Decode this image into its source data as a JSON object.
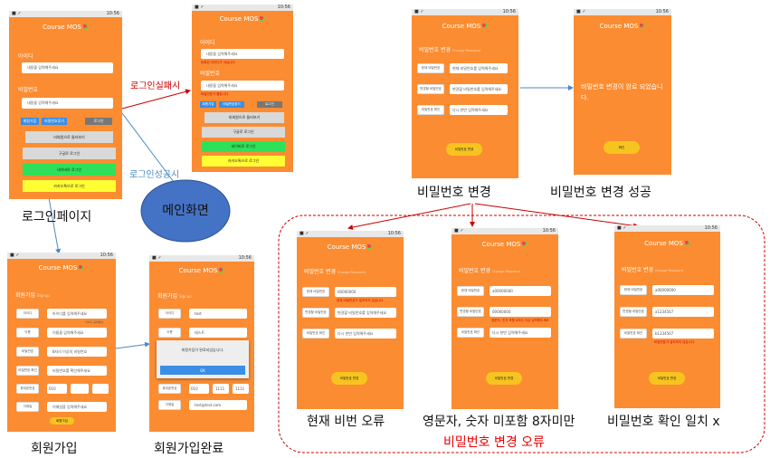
{
  "app": {
    "logo": "Course MOS",
    "time": "10:56"
  },
  "login": {
    "id_label": "아이디",
    "id_placeholder": "내용을 입력해주세요",
    "pw_label": "비밀번호",
    "pw_placeholder": "내용을 입력해주세요",
    "signup": "회원가입",
    "find_pw": "비밀번호찾기",
    "login": "로그인",
    "guest": "비회원으로 둘러보기",
    "google": "구글로 로그인",
    "naver": "네이버로 로그인",
    "kakao": "카카오톡으로 로그인",
    "error_id": "등록된 아이디가 아닙니다.",
    "error_pw": "비밀번호가 틀립니다."
  },
  "signup": {
    "title": "회원가입",
    "title_en": "Signup",
    "id_label": "아이디",
    "id_ph": "아이디를 입력해주세요",
    "dup_check": "아이디 중복확인",
    "name_label": "이름",
    "name_ph": "이름을 입력해주세요",
    "pw_label": "비밀번호",
    "pw_ph": "8자리 이상의 비밀번호",
    "pw2_label": "비밀번호 확인",
    "pw2_ph": "비밀번호를 확인해주세요",
    "phone_label": "휴대폰번호",
    "phone_prefix": "010",
    "email_label": "이메일",
    "email_ph": "이메일을 입력해주세요",
    "submit": "회원가입",
    "done_id": "test",
    "done_name": "테스트",
    "done_phone": [
      "010",
      "1111",
      "1111"
    ],
    "done_email": "test@test.com",
    "done_dialog": "회원가입이 완료되었습니다.",
    "ok": "OK"
  },
  "pwchange": {
    "title": "비밀번호 변경",
    "title_en": "Change Password",
    "cur_label": "현재 비밀번호",
    "cur_ph": "현재 비밀번호를 입력해주세요",
    "new_label": "변경할 비밀번호",
    "new_ph": "변경할 비밀번호를 입력해주세요",
    "confirm_label": "비밀번호 확인",
    "confirm_ph": "다시 한번 입력해주세요",
    "submit": "비밀번호 변경",
    "success_msg": "비밀번호 변경이 완료 되었습니다.",
    "confirm_btn": "확인",
    "e1_cur": "00000000",
    "e1_err": "현재 비밀번호가 일치하지 않습니다.",
    "e2_cur": "a00000000",
    "e2_new": "00000000",
    "e2_err": "영문자, 숫자 포함 8자리 이상 입력해주세요",
    "e3_cur": "a00000000",
    "e3_new": "a1234567",
    "e3_confirm": "b1234567",
    "e3_err": "비밀번호가 일치하지 않습니다."
  },
  "captions": {
    "login": "로그인페이지",
    "signup": "회원가입",
    "signup_done": "회원가입완료",
    "pw_change": "비밀번호 변경",
    "pw_success": "비밀번호 변경 성공",
    "main": "메인화면",
    "err1": "현재 비번 오류",
    "err2": "영문자, 숫자 미포함 8자미만",
    "err3": "비밀번호 확인 일치 x",
    "err_group": "비밀번호 변경 오류"
  },
  "notes": {
    "login_fail": "로그인실패시",
    "login_success": "로그인성공시"
  },
  "colors": {
    "phone": "#fb8c31",
    "naver": "#2ee05a",
    "kakao": "#ffff33",
    "yellow_btn": "#f7c41f",
    "blue_btn": "#3a8ee6"
  }
}
